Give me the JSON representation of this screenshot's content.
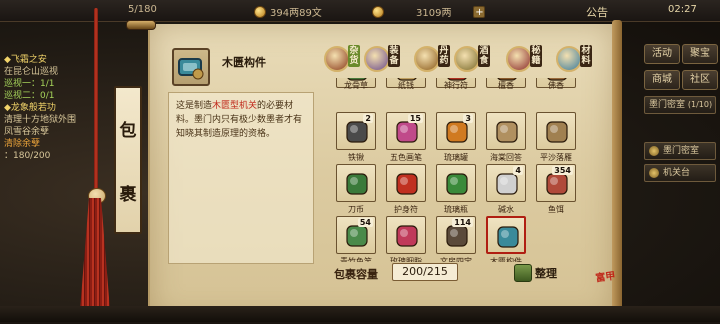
{
  "topbar": {
    "stamina": "5/180",
    "copper": "394两89文",
    "gold": "3109两",
    "announce": "公告",
    "time": "02:27"
  },
  "quest": {
    "title1": "飞霜之安",
    "line1": "在昆仑山巡视",
    "line2": "巡视一：1/1",
    "line3": "巡视二：0/1",
    "title2": "龙象般若功",
    "line4": "清理十方地狱外围",
    "line5": "凤雪谷余孽",
    "line6": "清除余孽",
    "line7": "：180/200"
  },
  "side_menu": {
    "btn1": "活动",
    "btn2": "聚宝",
    "btn3": "商城",
    "btn4": "社区",
    "location": "墨门密室",
    "level": "(1/10)",
    "entry1": "墨门密室",
    "entry2": "机关台"
  },
  "bag": {
    "title_top": "包",
    "title_bottom": "裹",
    "detail_name": "木匮构件",
    "desc_pre": "这是制造",
    "desc_highlight": "木匮型机关",
    "desc_post": "的必要材料。墨门内只有极少数墨者才有知晓其制造原理的资格。",
    "capacity_label": "包裹容量",
    "capacity_value": "200/215",
    "tidy_label": "整理",
    "stamp": "富甲"
  },
  "tabs": [
    {
      "label": "杂货",
      "color": "#8a3a1a",
      "active": true
    },
    {
      "label": "装备",
      "color": "#6a4a8a",
      "active": false
    },
    {
      "label": "丹药",
      "color": "#8a5a1a",
      "active": false
    },
    {
      "label": "酒食",
      "color": "#7a6a2a",
      "active": false
    },
    {
      "label": "秘籍",
      "color": "#8a2a2a",
      "active": false
    },
    {
      "label": "材料",
      "color": "#3a7a9a",
      "active": false
    }
  ],
  "items_top_row": [
    {
      "label": "龙骨草",
      "color": "#4a7a3a"
    },
    {
      "label": "纸钱",
      "color": "#c0a060"
    },
    {
      "label": "神行符",
      "color": "#b03020"
    },
    {
      "label": "檀香",
      "color": "#8a5a2a"
    },
    {
      "label": "佛香",
      "color": "#9a6a3a"
    }
  ],
  "items": [
    {
      "label": "铁锹",
      "count": "2",
      "color": "#4a4a4a"
    },
    {
      "label": "五色画笔",
      "count": "15",
      "color": "#c04a8a"
    },
    {
      "label": "琉璃罐",
      "count": "3",
      "color": "#d07a20"
    },
    {
      "label": "海棠回答",
      "count": "",
      "color": "#b09060"
    },
    {
      "label": "平沙落雁",
      "count": "",
      "color": "#a08050"
    },
    {
      "label": "刀币",
      "count": "",
      "color": "#3a7a3a"
    },
    {
      "label": "护身符",
      "count": "",
      "color": "#c03020"
    },
    {
      "label": "琉璃瓶",
      "count": "",
      "color": "#3a8a3a"
    },
    {
      "label": "碱水",
      "count": "4",
      "color": "#d0d0d0"
    },
    {
      "label": "鱼饵",
      "count": "354",
      "color": "#b04a3a"
    },
    {
      "label": "青竹鱼竿",
      "count": "54",
      "color": "#4a8a4a"
    },
    {
      "label": "玫瑰胭脂",
      "count": "",
      "color": "#c03a5a"
    },
    {
      "label": "文房四宝",
      "count": "114",
      "color": "#5a4a3a"
    },
    {
      "label": "木匮构件",
      "count": "",
      "color": "#3a8a9a",
      "selected": true
    }
  ]
}
